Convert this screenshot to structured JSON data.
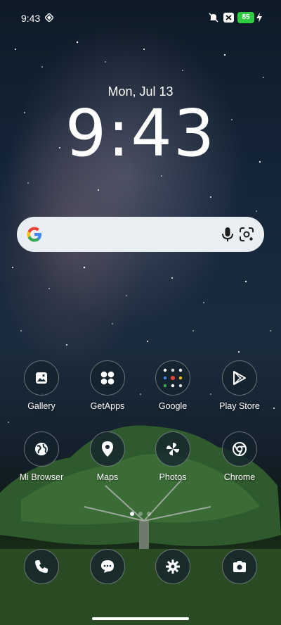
{
  "status_bar": {
    "time": "9:43",
    "battery": "85",
    "icons": [
      "location-diamond-icon",
      "mute-icon",
      "notification-x-icon",
      "battery-icon",
      "charging-bolt-icon"
    ],
    "battery_color": "#2ecc40"
  },
  "lockclock": {
    "date": "Mon, Jul 13",
    "time": "9:43"
  },
  "search_bar": {
    "icons": [
      "google-g-icon",
      "microphone-icon",
      "google-lens-icon"
    ]
  },
  "apps": [
    {
      "label": "Gallery",
      "icon": "gallery-icon"
    },
    {
      "label": "GetApps",
      "icon": "getapps-icon"
    },
    {
      "label": "Google",
      "icon": "google-folder-icon"
    },
    {
      "label": "Play Store",
      "icon": "play-store-icon"
    },
    {
      "label": "Mi Browser",
      "icon": "globe-icon"
    },
    {
      "label": "Maps",
      "icon": "map-pin-icon"
    },
    {
      "label": "Photos",
      "icon": "pinwheel-icon"
    },
    {
      "label": "Chrome",
      "icon": "chrome-icon"
    }
  ],
  "page_indicator": {
    "pages": 3,
    "current": 1
  },
  "dock": [
    {
      "icon": "phone-icon"
    },
    {
      "icon": "messages-icon"
    },
    {
      "icon": "settings-gear-icon"
    },
    {
      "icon": "camera-icon"
    }
  ]
}
